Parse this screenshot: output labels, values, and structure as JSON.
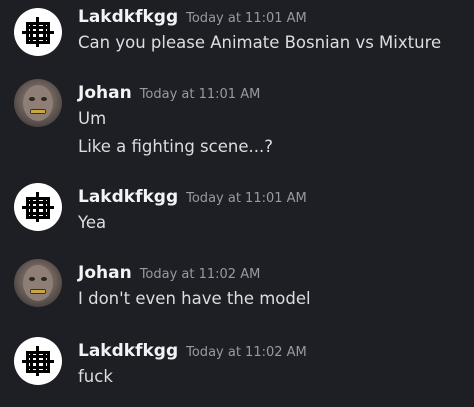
{
  "messages": [
    {
      "author": "Lakdkfkgg",
      "timestamp": "Today at 11:01 AM",
      "avatar": "grid-logo-avatar",
      "lines": [
        "Can you please Animate Bosnian vs Mixture"
      ]
    },
    {
      "author": "Johan",
      "timestamp": "Today at 11:01 AM",
      "avatar": "face-photo-avatar",
      "lines": [
        "Um",
        "Like a fighting scene...?"
      ]
    },
    {
      "author": "Lakdkfkgg",
      "timestamp": "Today at 11:01 AM",
      "avatar": "grid-logo-avatar",
      "lines": [
        "Yea"
      ]
    },
    {
      "author": "Johan",
      "timestamp": "Today at 11:02 AM",
      "avatar": "face-photo-avatar",
      "lines": [
        "I don't even have the model"
      ]
    },
    {
      "author": "Lakdkfkgg",
      "timestamp": "Today at 11:02 AM",
      "avatar": "grid-logo-avatar",
      "lines": [
        "fuck"
      ]
    }
  ],
  "colors": {
    "background": "#1e1f24",
    "author": "#f2f3f5",
    "timestamp": "#949ba4",
    "message_text": "#dbdee1"
  }
}
